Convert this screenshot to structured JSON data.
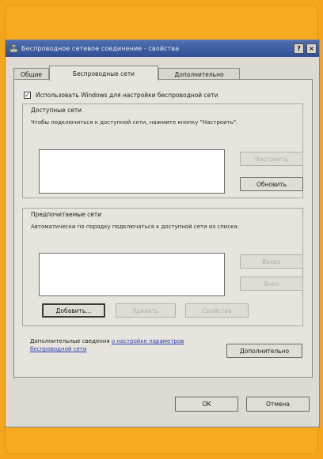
{
  "window": {
    "title": "Беспроводное сетевое соединение - свойства",
    "help_label": "?",
    "close_label": "×"
  },
  "tabs": [
    {
      "label": "Общие"
    },
    {
      "label": "Беспроводные сети"
    },
    {
      "label": "Дополнительно"
    }
  ],
  "use_windows": {
    "checked_mark": "✓",
    "label": "Использовать Windows для настройки беспроводной сети"
  },
  "available": {
    "title": "Доступные сети",
    "description": "Чтобы подключиться к доступной сети, нажмите кнопку \"Настроить\".",
    "configure_label": "Настроить",
    "refresh_label": "Обновить"
  },
  "preferred": {
    "title": "Предпочитаемые сети",
    "description": "Автоматически по порядку подключаться к доступной сети из списка:",
    "up_label": "Вверх",
    "down_label": "Вниз",
    "add_label": "Добавить...",
    "remove_label": "Удалить",
    "properties_label": "Свойства"
  },
  "more_info": {
    "prefix": "Дополнительные сведения ",
    "link": "о настройке параметров беспроводной сети",
    "advanced_label": "Дополнительно"
  },
  "footer": {
    "ok_label": "OK",
    "cancel_label": "Отмена"
  }
}
